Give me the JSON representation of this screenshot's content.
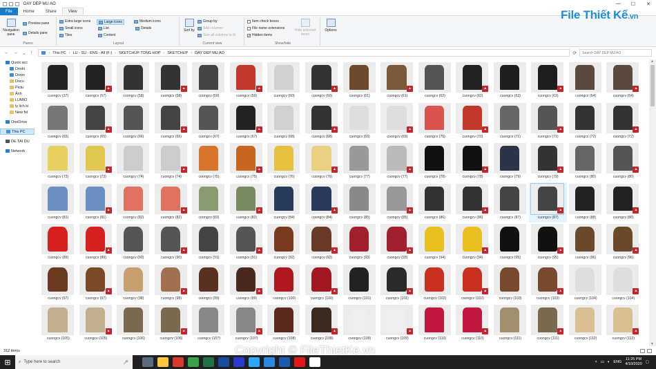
{
  "window": {
    "title": "DAY DEP MU AO"
  },
  "ribbon_tabs": [
    "File",
    "Home",
    "Share",
    "View"
  ],
  "ribbon": {
    "panes": {
      "navigation_pane": "Navigation pane",
      "preview_pane": "Preview pane",
      "details_pane": "Details pane",
      "label": "Panes"
    },
    "layout": {
      "items": [
        "Extra large icons",
        "Large icons",
        "Medium icons",
        "Small icons",
        "List",
        "Details",
        "Tiles",
        "Content"
      ],
      "selected": "Large icons",
      "label": "Layout"
    },
    "current_view": {
      "sort_by": "Sort by",
      "group_by": "Group by",
      "add_columns": "Add columns",
      "size_columns": "Size all columns to fit",
      "label": "Current view"
    },
    "show_hide": {
      "item_check_boxes": "Item check boxes",
      "file_name_extensions": "File name extensions",
      "hidden_items": "Hidden items",
      "hide_selected": "Hide selected items",
      "label": "Show/hide"
    },
    "options": "Options"
  },
  "address": {
    "path": [
      "This PC",
      "LU - SU - ENS - All (F:)",
      "SKETCHUP TONG HOP",
      "SKETCHUP",
      "DAY DEP MU AO"
    ],
    "search_placeholder": "Search DAY DEP MU AO"
  },
  "nav_pane": [
    {
      "label": "Quick acc",
      "level": 0,
      "color": "#2b7cd3"
    },
    {
      "label": "Deskt",
      "level": 1,
      "color": "#3d8fd9"
    },
    {
      "label": "Down",
      "level": 1,
      "color": "#3d8fd9"
    },
    {
      "label": "Docu",
      "level": 1,
      "color": "#e0c16a"
    },
    {
      "label": "Pictu",
      "level": 1,
      "color": "#e0c16a"
    },
    {
      "label": "Ảnh",
      "level": 1,
      "color": "#e8c25a"
    },
    {
      "label": "LUMIO",
      "level": 1,
      "color": "#e8c25a"
    },
    {
      "label": "ly lich ki",
      "level": 1,
      "color": "#e8c25a"
    },
    {
      "label": "New fol",
      "level": 1,
      "color": "#e8c25a"
    },
    {
      "label": "OneDrive",
      "level": 0,
      "color": "#2b7cd3",
      "gap": true
    },
    {
      "label": "This PC",
      "level": 0,
      "color": "#4a90d9",
      "gap": true,
      "selected": true
    },
    {
      "label": "DE TAI DU",
      "level": 0,
      "color": "#555555",
      "gap": true
    },
    {
      "label": "Network",
      "level": 0,
      "color": "#2b7cd3",
      "gap": true
    }
  ],
  "files": [
    [
      "cuongcv (37)",
      "cuongcv (57)",
      "cuongcv (58)",
      "cuongcv (58)",
      "cuongcv (59)",
      "cuongcv (59)",
      "cuongcv (60)",
      "cuongcv (60)",
      "cuongcv (61)",
      "cuongcv (61)",
      "cuongcv (62)",
      "cuongcv (62)",
      "cuongcv (63)",
      "cuongcv (63)",
      "cuongcv (64)",
      "cuongcv (64)"
    ],
    [
      "cuongcv (65)",
      "cuongcv (65)",
      "cuongcv (66)",
      "cuongcv (66)",
      "cuongcv (67)",
      "cuongcv (67)",
      "cuongcv (68)",
      "cuongcv (68)",
      "cuongcv (69)",
      "cuongcv (69)",
      "cuongcv (70)",
      "cuongcv (70)",
      "cuongcv (71)",
      "cuongcv (71)",
      "cuongcv (72)",
      "cuongcv (72)"
    ],
    [
      "cuongcv (73)",
      "cuongcv (73)",
      "cuongcv (74)",
      "cuongcv (74)",
      "cuongcv (75)",
      "cuongcv (75)",
      "cuongcv (76)",
      "cuongcv (76)",
      "cuongcv (77)",
      "cuongcv (77)",
      "cuongcv (78)",
      "cuongcv (78)",
      "cuongcv (79)",
      "cuongcv (79)",
      "cuongcv (80)",
      "cuongcv (80)"
    ],
    [
      "cuongcv (81)",
      "cuongcv (81)",
      "cuongcv (82)",
      "cuongcv (82)",
      "cuongcv (83)",
      "cuongcv (83)",
      "cuongcv (84)",
      "cuongcv (84)",
      "cuongcv (85)",
      "cuongcv (85)",
      "cuongcv (86)",
      "cuongcv (86)",
      "cuongcv (87)",
      "cuongcv (87)",
      "cuongcv (88)",
      "cuongcv (88)"
    ],
    [
      "cuongcv (89)",
      "cuongcv (89)",
      "cuongcv (90)",
      "cuongcv (90)",
      "cuongcv (91)",
      "cuongcv (91)",
      "cuongcv (92)",
      "cuongcv (92)",
      "cuongcv (93)",
      "cuongcv (93)",
      "cuongcv (94)",
      "cuongcv (94)",
      "cuongcv (95)",
      "cuongcv (95)",
      "cuongcv (96)",
      "cuongcv (96)"
    ],
    [
      "cuongcv (97)",
      "cuongcv (97)",
      "cuongcv (98)",
      "cuongcv (98)",
      "cuongcv (99)",
      "cuongcv (99)",
      "cuongcv (100)",
      "cuongcv (100)",
      "cuongcv (101)",
      "cuongcv (101)",
      "cuongcv (102)",
      "cuongcv (102)",
      "cuongcv (103)",
      "cuongcv (103)",
      "cuongcv (104)",
      "cuongcv (104)"
    ],
    [
      "cuongcv (105)",
      "cuongcv (105)",
      "cuongcv (106)",
      "cuongcv (106)",
      "cuongcv (107)",
      "cuongcv (107)",
      "cuongcv (108)",
      "cuongcv (108)",
      "cuongcv (109)",
      "cuongcv (109)",
      "cuongcv (110)",
      "cuongcv (110)",
      "cuongcv (111)",
      "cuongcv (111)",
      "cuongcv (112)",
      "cuongcv (112)"
    ]
  ],
  "thumb_colors": [
    [
      "#222",
      "#222",
      "#333",
      "#333",
      "#444",
      "#c0392b",
      "#d0d0d0",
      "#333",
      "#6b4a2e",
      "#7a5a3a",
      "#555",
      "#222",
      "#1e1e1e",
      "#1e1e1e",
      "#5a4a40",
      "#5a4a40"
    ],
    [
      "#777",
      "#444",
      "#555",
      "#444",
      "#555",
      "#222",
      "#d0d0d0",
      "#333",
      "#ddd",
      "#ddd",
      "#d9534f",
      "#c0392b",
      "#666",
      "#555",
      "#333",
      "#333"
    ],
    [
      "#e8d060",
      "#e0c850",
      "#ccc",
      "#ccc",
      "#d9752a",
      "#c8651f",
      "#e8c040",
      "#e8d080",
      "#999",
      "#bbb",
      "#111",
      "#111",
      "#2c3448",
      "#333",
      "#666",
      "#555"
    ],
    [
      "#6a8fc0",
      "#6a8fc0",
      "#e07060",
      "#e07060",
      "#8a9a70",
      "#7a8a60",
      "#2a3a5a",
      "#2a3a5a",
      "#888",
      "#999",
      "#333",
      "#333",
      "#444",
      "#444",
      "#222",
      "#222"
    ],
    [
      "#d62020",
      "#d62020",
      "#555",
      "#555",
      "#444",
      "#555",
      "#7a3a20",
      "#6a3a28",
      "#a02030",
      "#a02030",
      "#e8c020",
      "#e8c020",
      "#111",
      "#111",
      "#6a4a2a",
      "#6a4a2a"
    ],
    [
      "#6a3a20",
      "#7a4a28",
      "#c8a070",
      "#a07050",
      "#5a3020",
      "#4a2a20",
      "#b01820",
      "#a01820",
      "#222",
      "#2a2a2a",
      "#c83020",
      "#c83020",
      "#7a4a30",
      "#7a4a30",
      "#ddd",
      "#ddd"
    ],
    [
      "#c0b090",
      "#c0b090",
      "#7a6a50",
      "#7a6a50",
      "#888",
      "#888",
      "#5a2a20",
      "#3a2a20",
      "#eee",
      "#eee",
      "#c01840",
      "#c01840",
      "#a09070",
      "#7a6a50",
      "#d8c090",
      "#d8c090"
    ]
  ],
  "selected_file": {
    "row": 3,
    "col": 13
  },
  "status": {
    "item_count": "312 items"
  },
  "watermark": {
    "logo_main": "File Thiết Kế",
    "logo_sub": ".vn",
    "copyright": "Copyright © FileThietKe.vn"
  },
  "taskbar": {
    "search_placeholder": "Type here to search",
    "apps": [
      "#5a6a80",
      "#ffc83d",
      "#d63a2a",
      "#3aa04a",
      "#217346",
      "#1a4aa0",
      "#2a3ad0",
      "#31a8ff",
      "#2a8ae0",
      "#1e5ab0",
      "#e01a1a",
      "#ffffff"
    ],
    "language": "ENG",
    "time": "11:25 PM",
    "date": "4/10/2020"
  }
}
